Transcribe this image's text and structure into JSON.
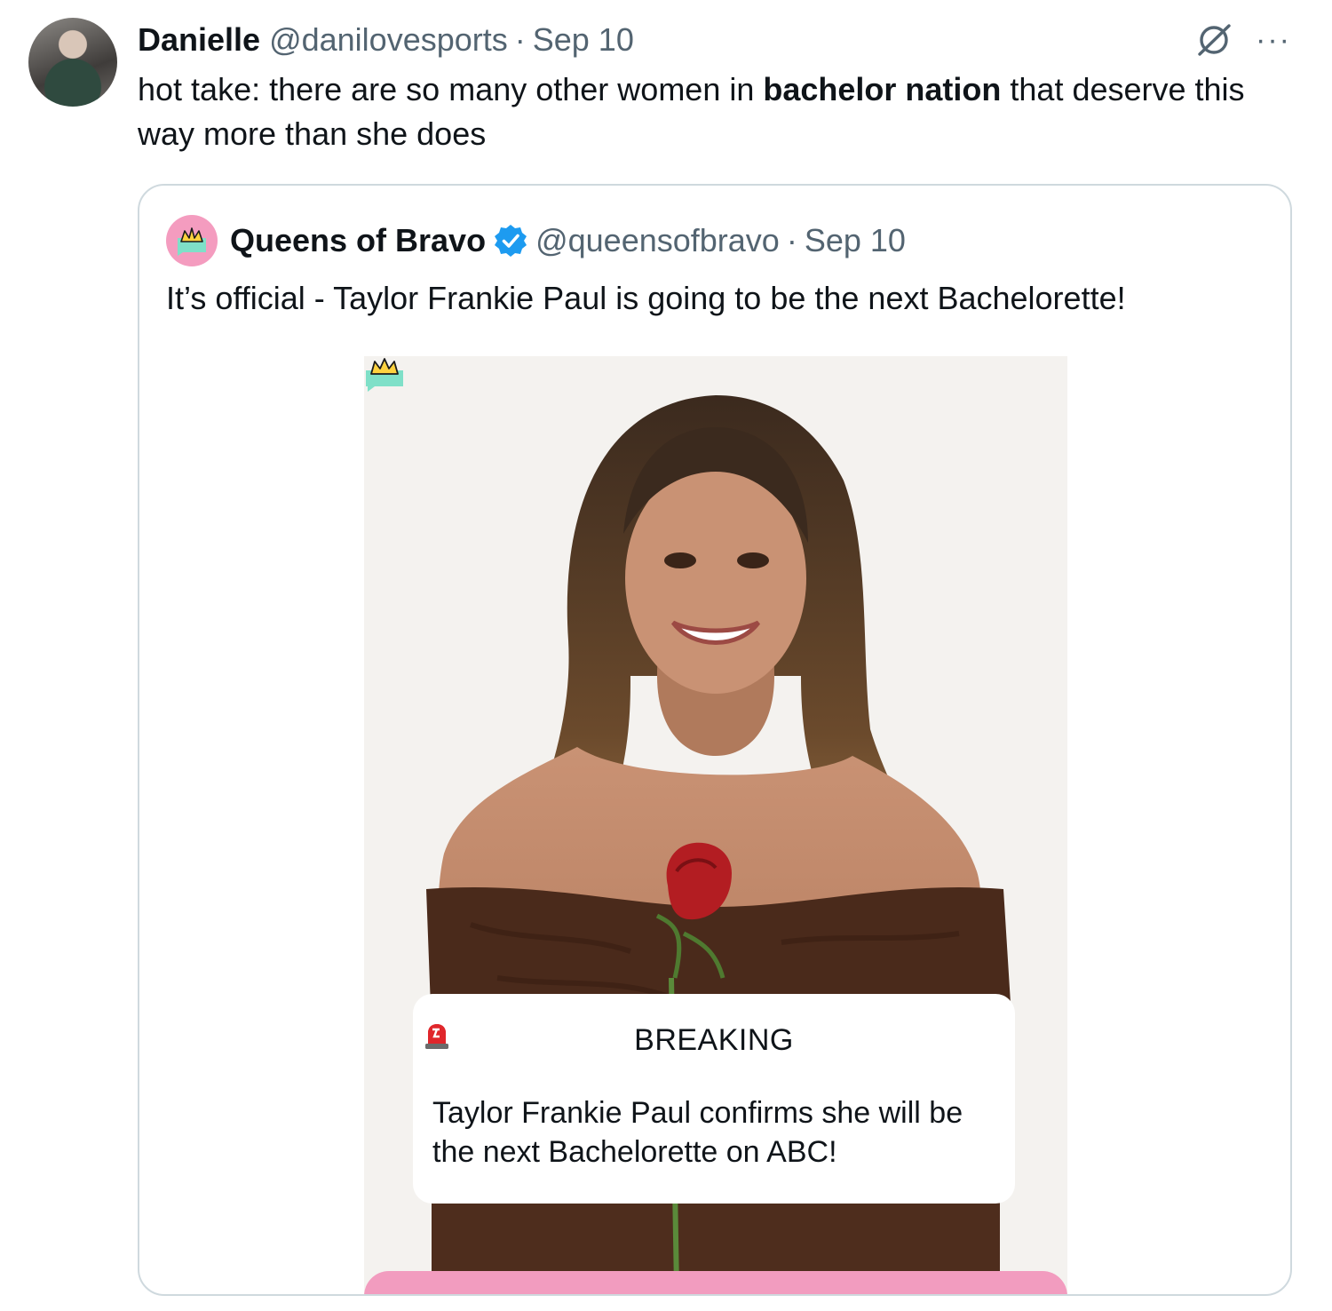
{
  "tweet": {
    "author_name": "Danielle",
    "handle": "@danilovesports",
    "separator": "·",
    "date": "Sep 10",
    "text_before": "hot take: there are so many other women in ",
    "text_bold": "bachelor nation",
    "text_after": " that deserve this way more than she does",
    "more_label": "···"
  },
  "quote": {
    "author_name": "Queens of Bravo",
    "handle": "@queensofbravo",
    "separator": "·",
    "date": "Sep 10",
    "text": "It’s official - Taylor Frankie Paul is going to be the next Bachelorette!",
    "image": {
      "breaking_label": "BREAKING",
      "card_text": "Taylor Frankie Paul confirms she will be the next Bachelorette on ABC!"
    }
  },
  "colors": {
    "text": "#0f1419",
    "muted": "#536471",
    "border": "#cfd9de",
    "verified": "#1d9bf0",
    "brand_pink": "#f29cbf",
    "brand_teal": "#7fe0c8"
  }
}
